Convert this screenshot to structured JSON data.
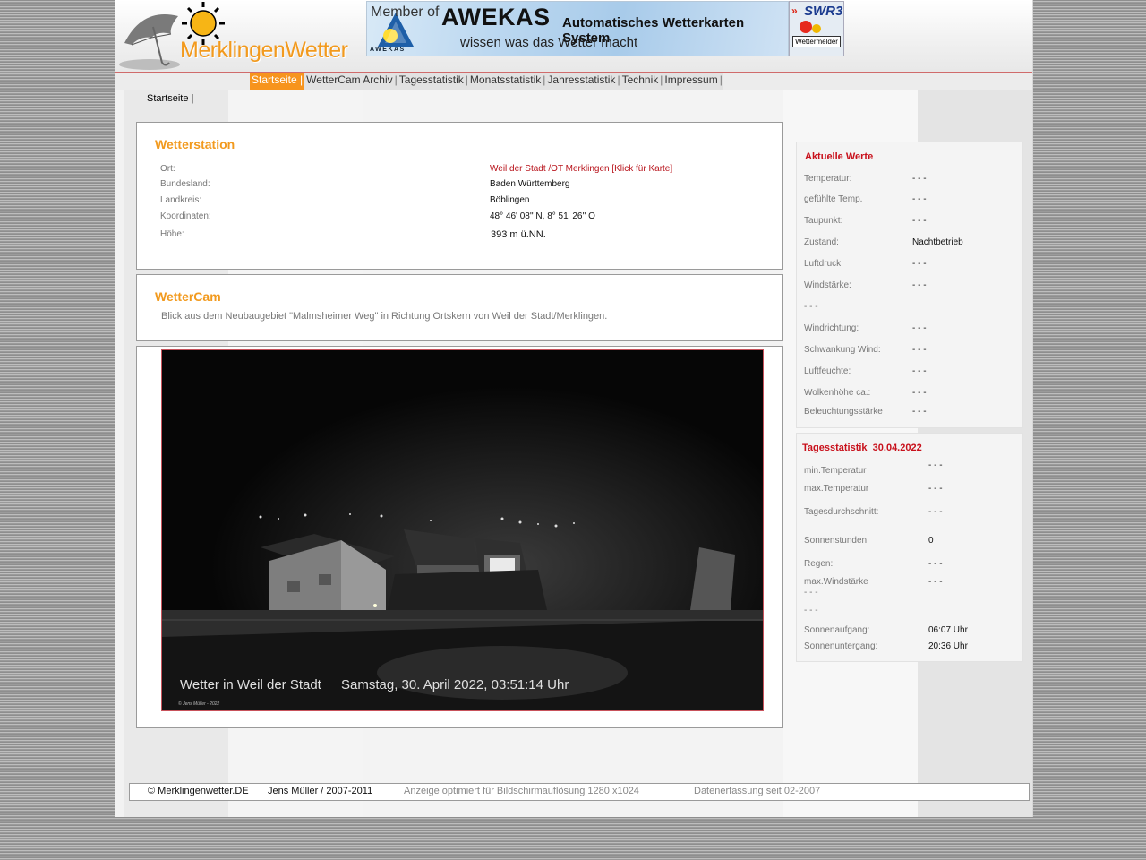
{
  "header": {
    "logo_text": "MerklingenWetter",
    "awekas_member": "Member of",
    "awekas_brand": "AWEKAS",
    "awekas_full": "Automatisches Wetterkarten System",
    "awekas_slogan": "wissen was das Wetter macht",
    "awekas_small": "AWEKAS",
    "swr_logo": "SWR3",
    "swr_badge": "Wettermelder"
  },
  "nav": {
    "items": [
      {
        "label": "Startseite"
      },
      {
        "label": "WetterCam Archiv"
      },
      {
        "label": "Tagesstatistik"
      },
      {
        "label": "Monatsstatistik"
      },
      {
        "label": "Jahresstatistik"
      },
      {
        "label": "Technik"
      },
      {
        "label": "Impressum"
      }
    ]
  },
  "breadcrumb": "Startseite |",
  "station": {
    "title": "Wetterstation",
    "rows": [
      {
        "label": "Ort:",
        "value": "Weil der Stadt /OT Merklingen [Klick für Karte]"
      },
      {
        "label": "Bundesland:",
        "value": "Baden Württemberg"
      },
      {
        "label": "Landkreis:",
        "value": "Böblingen"
      },
      {
        "label": "Koordinaten:",
        "value": "48° 46' 08'' N, 8° 51' 26'' O"
      },
      {
        "label": "Höhe:",
        "value": "393 m ü.NN."
      }
    ]
  },
  "wettercam": {
    "title": "WetterCam",
    "description": "Blick aus dem Neubaugebiet \"Malmsheimer Weg\" in Richtung Ortskern von Weil der Stadt/Merklingen.",
    "overlay_left": "Wetter in Weil der Stadt",
    "overlay_right": "Samstag, 30. April 2022, 03:51:14 Uhr",
    "copyright": "© Jens Müller - 2022"
  },
  "current": {
    "title": "Aktuelle Werte",
    "rows": [
      {
        "label": "Temperatur:",
        "value": "- - -"
      },
      {
        "label": "gefühlte Temp.",
        "value": "- - -"
      },
      {
        "label": "Taupunkt:",
        "value": "- - -"
      },
      {
        "label": "Zustand:",
        "value": "Nachtbetrieb"
      },
      {
        "label": "Luftdruck:",
        "value": "- - -"
      },
      {
        "label": "Windstärke:",
        "value": "- - -"
      },
      {
        "label": "- - -",
        "value": ""
      },
      {
        "label": "Windrichtung:",
        "value": "- - -"
      },
      {
        "label": "Schwankung Wind:",
        "value": "- - -"
      },
      {
        "label": "Luftfeuchte:",
        "value": "- - -"
      },
      {
        "label": "Wolkenhöhe ca.:",
        "value": "- - -"
      },
      {
        "label": "Beleuchtungsstärke",
        "value": "- - -"
      }
    ]
  },
  "daily": {
    "title": "Tagesstatistik  30.04.2022",
    "min_temp_label": "min.Temperatur",
    "min_temp_value": "- - -",
    "max_temp_label": "max.Temperatur",
    "max_temp_value": "- - -",
    "avg_label": "Tagesdurchschnitt:",
    "avg_value": "- - -",
    "sun_label": "Sonnenstunden",
    "sun_value": "0",
    "rain_label": "Regen:",
    "rain_value": "- - -",
    "maxwind_label": "max.Windstärke",
    "maxwind_value": "- - -",
    "maxwind_sub": "- - -",
    "extra": "- - -",
    "sunrise_label": "Sonnenaufgang:",
    "sunrise_value": "06:07 Uhr",
    "sunset_label": "Sonnenuntergang:",
    "sunset_value": "20:36 Uhr"
  },
  "footer": {
    "site": "© Merklingenwetter.DE",
    "author": "Jens Müller / 2007-2011",
    "resolution": "Anzeige optimiert für Bildschirmauflösung 1280 x1024",
    "since": "Datenerfassung seit 02-2007"
  }
}
